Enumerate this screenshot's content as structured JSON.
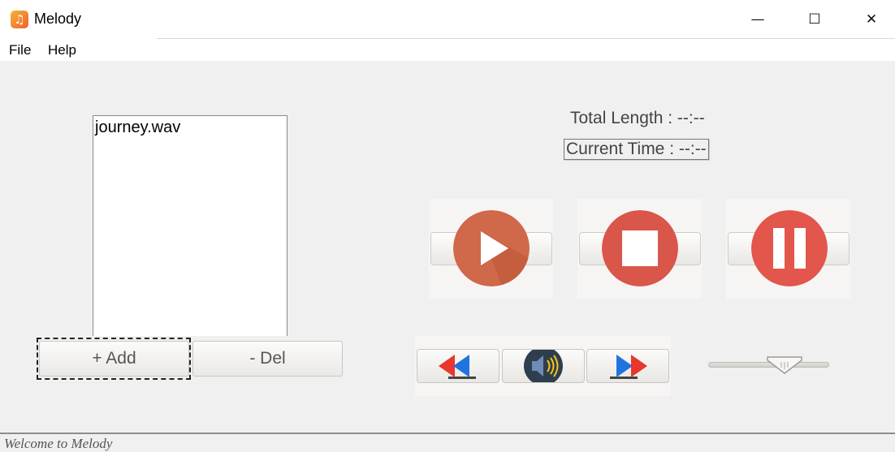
{
  "window": {
    "title": "Melody",
    "minimize_glyph": "—",
    "maximize_glyph": "☐",
    "close_glyph": "✕"
  },
  "menu": [
    "File",
    "Help"
  ],
  "playlist": {
    "items": [
      "journey.wav"
    ]
  },
  "buttons": {
    "add": "+ Add",
    "del": "- Del"
  },
  "time": {
    "total_length": "Total Length : --:--",
    "current_time": "Current Time : --:--"
  },
  "controls": {
    "play_icon": "play-icon",
    "stop_icon": "stop-icon",
    "pause_icon": "pause-icon",
    "rewind_icon": "rewind-icon",
    "volume_icon": "speaker-icon",
    "forward_icon": "fast-forward-icon",
    "play_color": "#d0684a",
    "stop_color": "#d9574a",
    "pause_color": "#e2564c"
  },
  "volume": {
    "level": 0.6
  },
  "status": "Welcome to Melody"
}
